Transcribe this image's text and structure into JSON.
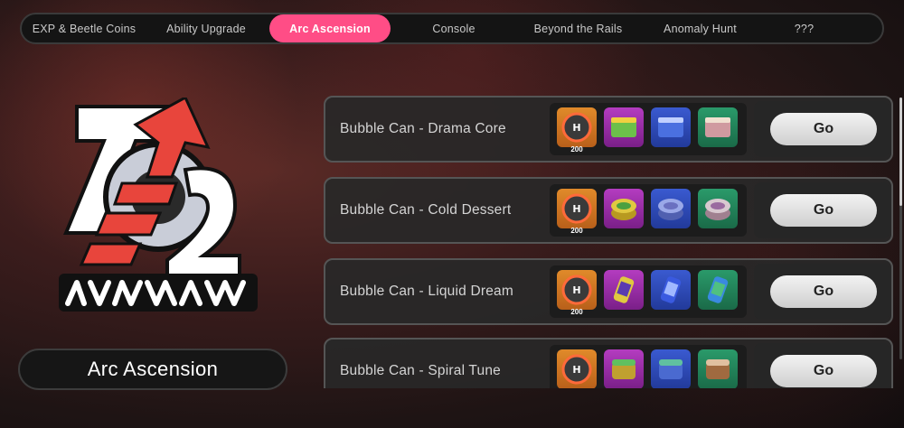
{
  "tabs": [
    {
      "label": "EXP & Beetle Coins",
      "active": false
    },
    {
      "label": "Ability Upgrade",
      "active": false
    },
    {
      "label": "Arc Ascension",
      "active": true
    },
    {
      "label": "Console",
      "active": false
    },
    {
      "label": "Beyond the Rails",
      "active": false
    },
    {
      "label": "Anomaly Hunt",
      "active": false
    },
    {
      "label": "???",
      "active": false
    }
  ],
  "logo": {
    "text": "ℳℰℛ / Skysoul arc logo"
  },
  "left_title": "Arc Ascension",
  "rows": [
    {
      "label": "Bubble Can - Drama Core",
      "first_qty": "200",
      "go": "Go",
      "icons": [
        "arc-chip-icon",
        "green-cube-can-icon",
        "blue-cube-can-icon",
        "pink-cube-can-icon"
      ]
    },
    {
      "label": "Bubble Can - Cold Dessert",
      "first_qty": "200",
      "go": "Go",
      "icons": [
        "arc-chip-icon",
        "gold-tin-icon",
        "blue-tin-icon",
        "purple-tin-icon"
      ]
    },
    {
      "label": "Bubble Can - Liquid Dream",
      "first_qty": "200",
      "go": "Go",
      "icons": [
        "arc-chip-icon",
        "purple-can-icon",
        "blue-can-icon",
        "green-can-icon"
      ]
    },
    {
      "label": "Bubble Can - Spiral Tune",
      "first_qty": "",
      "go": "Go",
      "icons": [
        "arc-chip-icon",
        "gold-jar-icon",
        "blue-jar-icon",
        "bronze-jar-icon"
      ]
    }
  ]
}
